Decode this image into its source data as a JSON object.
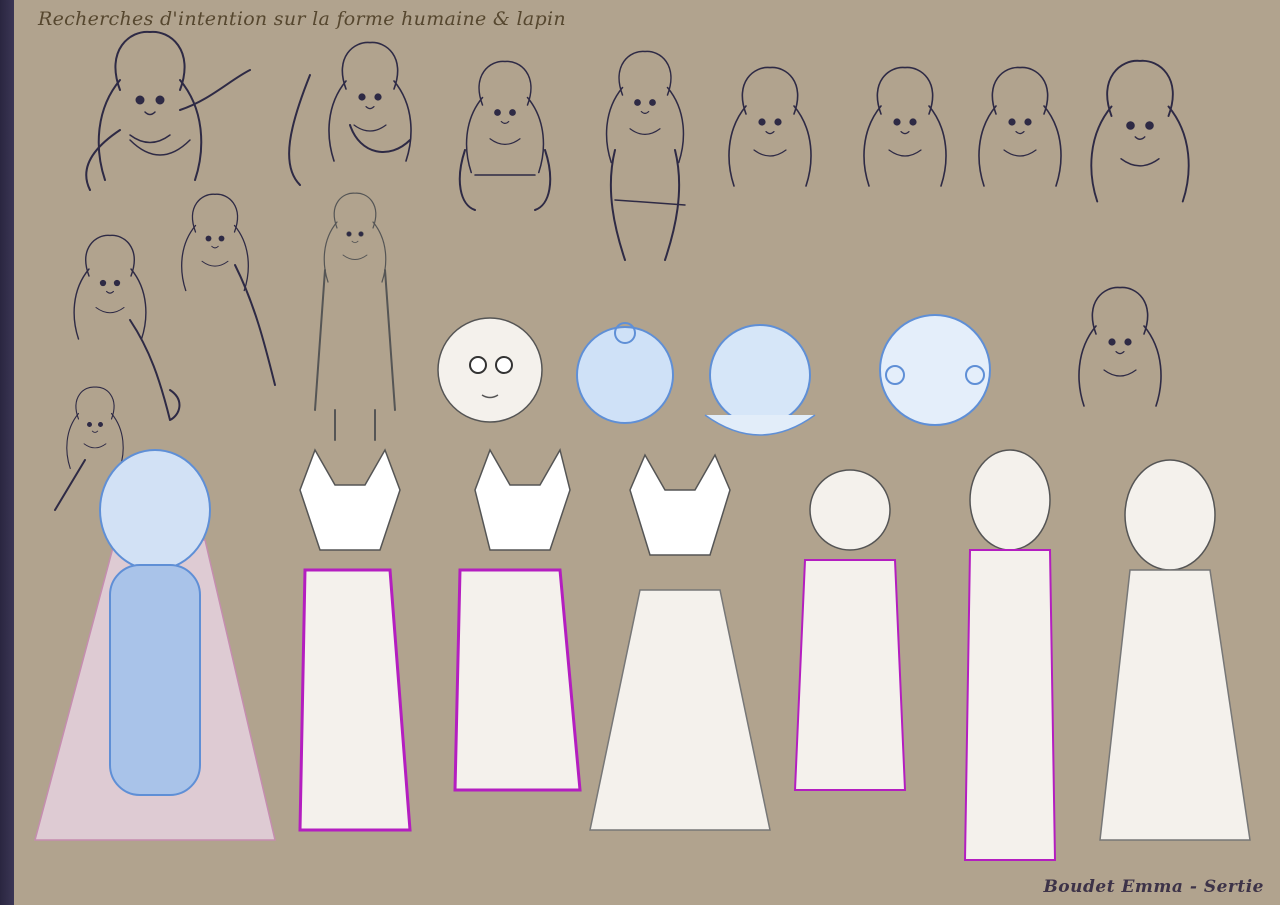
{
  "title": "Recherches d'intention sur la forme humaine & lapin",
  "credit": "Boudet Emma - Sertie",
  "colors": {
    "background": "#b1a38e",
    "frame": "#2f2b45",
    "ink_dark": "#2e2a45",
    "ink_blue": "#5f8fd6",
    "ink_magenta": "#b41ec0",
    "pencil": "#6b6b6b",
    "paper": "#f4f1ec"
  }
}
